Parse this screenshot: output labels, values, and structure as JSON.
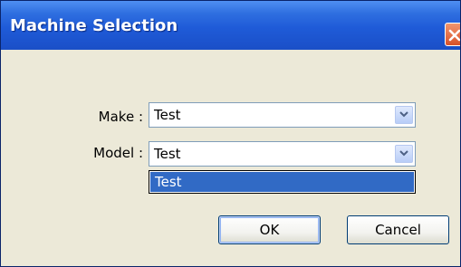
{
  "dialog": {
    "title": "Machine Selection"
  },
  "form": {
    "make_label": "Make :",
    "make_value": "Test",
    "model_label": "Model :",
    "model_value": "Test",
    "model_options": [
      "Test"
    ]
  },
  "buttons": {
    "ok_label": "OK",
    "cancel_label": "Cancel"
  },
  "icons": {
    "close": "close-icon",
    "dropdown": "chevron-down-icon"
  },
  "colors": {
    "titlebar": "#1f5bd8",
    "selection": "#316ac5",
    "close_button": "#d9522a",
    "window_background": "#ece9d8"
  }
}
